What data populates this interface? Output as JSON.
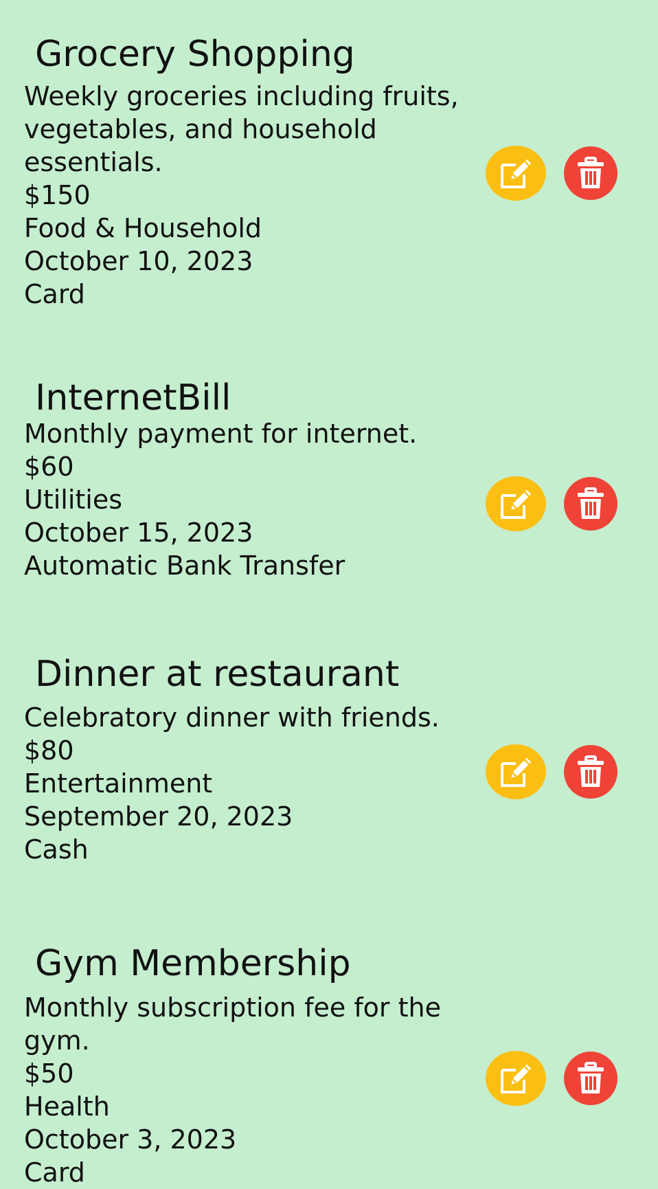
{
  "expenses": [
    {
      "title": "Grocery Shopping",
      "description": "Weekly groceries including fruits, vegetables, and household essentials.",
      "amount": "$150",
      "category": "Food & Household",
      "date": "October 10, 2023",
      "payment_method": "Card"
    },
    {
      "title": "InternetBill",
      "description": "Monthly payment for internet.",
      "amount": "$60",
      "category": "Utilities",
      "date": "October 15, 2023",
      "payment_method": "Automatic Bank Transfer"
    },
    {
      "title": "Dinner at restaurant",
      "description": "Celebratory dinner with friends.",
      "amount": "$80",
      "category": "Entertainment",
      "date": "September 20, 2023",
      "payment_method": "Cash"
    },
    {
      "title": "Gym Membership",
      "description": "Monthly subscription fee for the gym.",
      "amount": "$50",
      "category": "Health",
      "date": "October 3, 2023",
      "payment_method": "Card"
    }
  ],
  "icons": {
    "edit": "edit-icon",
    "delete": "trash-icon"
  },
  "colors": {
    "background": "#c5eecf",
    "edit_button": "#fbbf13",
    "delete_button": "#ef4337",
    "icon": "#ffffff"
  }
}
